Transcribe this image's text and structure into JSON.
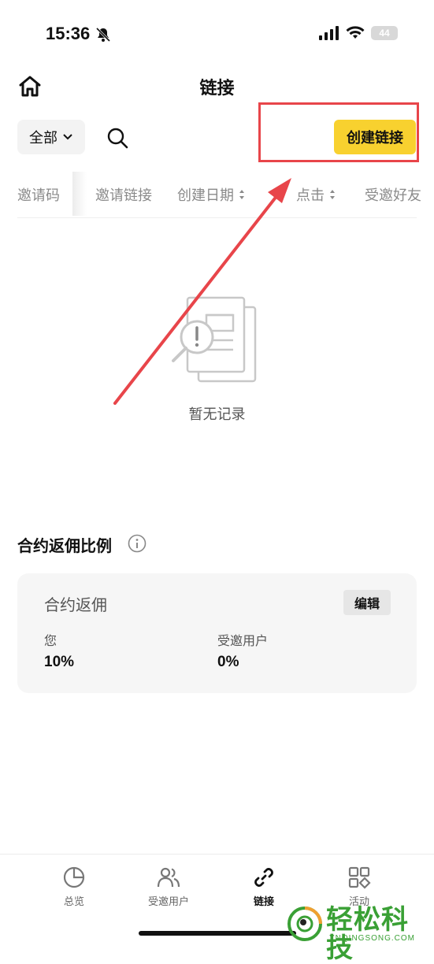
{
  "status_bar": {
    "time": "15:36",
    "battery": "44"
  },
  "header": {
    "title": "链接"
  },
  "toolbar": {
    "filter_label": "全部",
    "create_button": "创建链接"
  },
  "columns": [
    {
      "label": "邀请码"
    },
    {
      "label": "邀请链接"
    },
    {
      "label": "创建日期"
    },
    {
      "label": "点击"
    },
    {
      "label": "受邀好友"
    }
  ],
  "empty_state": {
    "text": "暂无记录"
  },
  "rebate": {
    "section_title": "合约返佣比例",
    "card_title": "合约返佣",
    "edit_button": "编辑",
    "you_label": "您",
    "you_value": "10%",
    "invitee_label": "受邀用户",
    "invitee_value": "0%"
  },
  "bottom_nav": [
    {
      "label": "总览",
      "icon": "pie-chart-icon",
      "active": false
    },
    {
      "label": "受邀用户",
      "icon": "users-icon",
      "active": false
    },
    {
      "label": "链接",
      "icon": "link-icon",
      "active": true
    },
    {
      "label": "活动",
      "icon": "grid-icon",
      "active": false
    }
  ],
  "watermark": {
    "text": "轻松科技",
    "sub": "YNQINGSONG.COM"
  },
  "colors": {
    "accent": "#f8d12f",
    "highlight": "#e8454a",
    "watermark": "#3aa035"
  }
}
